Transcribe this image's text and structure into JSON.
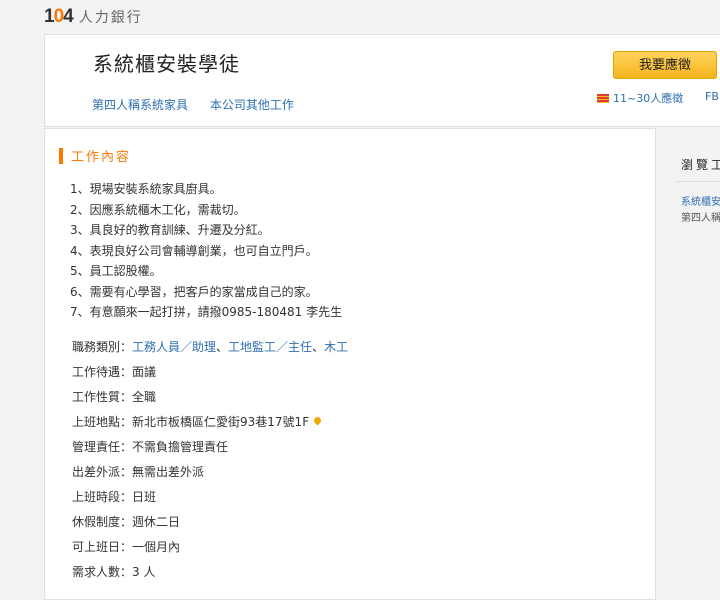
{
  "brand": {
    "number": "104",
    "name": "人力銀行"
  },
  "header": {
    "job_title": "系統櫃安裝學徒",
    "company_link": "第四人稱系統家具",
    "other_jobs_link": "本公司其他工作",
    "apply_label": "我要應徵",
    "applicants": "11~30人應徵",
    "fb": "FB"
  },
  "section": {
    "title": "工作內容"
  },
  "description": [
    "1、現場安裝系統家具廚具。",
    "2、因應系統櫃木工化，需裁切。",
    "3、具良好的教育訓練、升遷及分紅。",
    "4、表現良好公司會輔導創業，也可自立門戶。",
    "5、員工認股權。",
    "6、需要有心學習，把客戶的家當成自己的家。",
    "7、有意願來一起打拼，請撥0985-180481 李先生"
  ],
  "details": {
    "category": {
      "label": "職務類別：",
      "values": [
        "工務人員／助理",
        "工地監工／主任",
        "木工"
      ],
      "sep": "、"
    },
    "salary": {
      "label": "工作待遇：",
      "value": "面議"
    },
    "nature": {
      "label": "工作性質：",
      "value": "全職"
    },
    "location": {
      "label": "上班地點：",
      "value": "新北市板橋區仁愛街93巷17號1F"
    },
    "management": {
      "label": "管理責任：",
      "value": "不需負擔管理責任"
    },
    "travel": {
      "label": "出差外派：",
      "value": "無需出差外派"
    },
    "shift": {
      "label": "上班時段：",
      "value": "日班"
    },
    "holiday": {
      "label": "休假制度：",
      "value": "週休二日"
    },
    "start": {
      "label": "可上班日：",
      "value": "一個月內"
    },
    "headcount": {
      "label": "需求人數：",
      "value": "3 人"
    }
  },
  "sidebar": {
    "title": "瀏覽工",
    "job": "系統櫃安",
    "company": "第四人稱"
  },
  "colors": {
    "accent": "#ff7800",
    "link": "#2e6fb0",
    "button": "#f5b41c"
  },
  "icons": {
    "location": "map-pin-icon",
    "applicants": "flag-icon"
  }
}
